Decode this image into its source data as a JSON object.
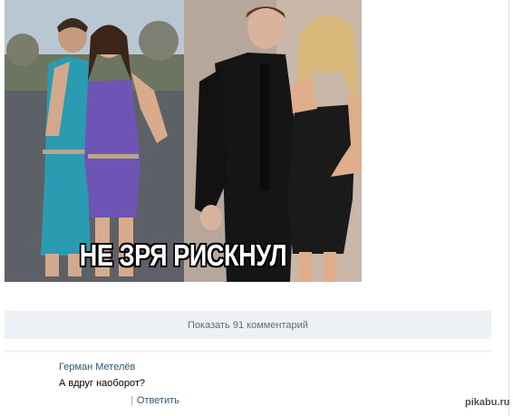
{
  "post": {
    "image_caption": "НЕ ЗРЯ РИСКНУЛ"
  },
  "comments": {
    "show_label": "Показать 91 комментарий",
    "items": [
      {
        "author": "Герман Метелёв",
        "text": "А вдруг наоборот?",
        "reply_label": "Ответить"
      }
    ]
  },
  "watermark": "pikabu.ru",
  "colors": {
    "link": "#2b587a",
    "button_bg": "#edf1f5",
    "button_text": "#5f6d7a"
  }
}
